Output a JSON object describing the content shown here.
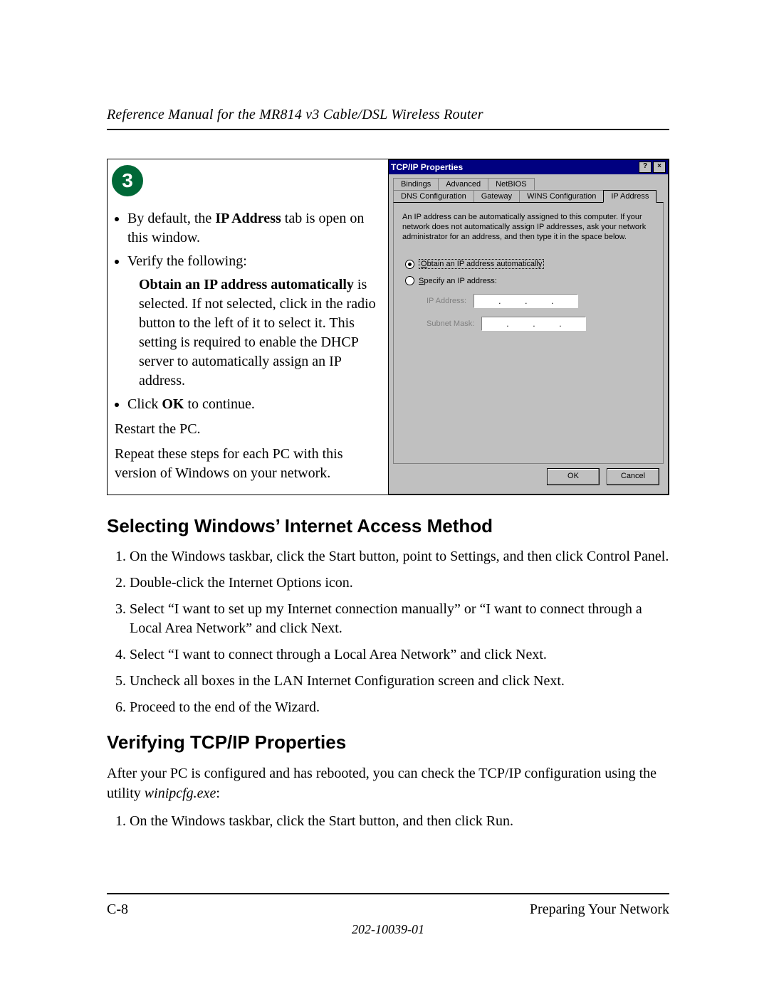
{
  "header": {
    "running_title": "Reference Manual for the MR814 v3 Cable/DSL Wireless Router"
  },
  "step": {
    "number": "3",
    "bullet1_pre": "By default, the ",
    "bullet1_bold": "IP Address",
    "bullet1_post": " tab is open on this window.",
    "bullet2": "Verify the following:",
    "obtain_phrase": "Obtain an IP address automatically",
    "obtain_rest": " is selected. If not selected, click in the radio button to the left of it to select it.  This setting is required to enable the DHCP server to automatically assign an IP address.",
    "bullet3_pre": "Click ",
    "bullet3_bold": "OK",
    "bullet3_post": " to continue.",
    "restart": "Restart the PC.",
    "repeat": "Repeat these steps for each PC with this version of Windows on your network."
  },
  "dialog": {
    "title": "TCP/IP Properties",
    "help_btn": "?",
    "close_btn": "×",
    "tabs_row1": {
      "bindings": "Bindings",
      "advanced": "Advanced",
      "netbios": "NetBIOS"
    },
    "tabs_row2": {
      "dns": "DNS Configuration",
      "gateway": "Gateway",
      "wins": "WINS Configuration",
      "ip": "IP Address"
    },
    "desc": "An IP address can be automatically assigned to this computer. If your network does not automatically assign IP addresses, ask your network administrator for an address, and then type it in the space below.",
    "radio_obtain_u": "O",
    "radio_obtain_rest": "btain an IP address automatically",
    "radio_specify_u": "S",
    "radio_specify_rest": "pecify an IP address:",
    "ip_label": "IP Address:",
    "subnet_label": "Subnet Mask:",
    "ok": "OK",
    "cancel": "Cancel"
  },
  "section1": {
    "title": "Selecting Windows’ Internet Access Method",
    "items": [
      "On the Windows taskbar, click the Start button, point to Settings, and then click Control Panel.",
      "Double-click the Internet Options icon.",
      "Select “I want to set up my Internet connection manually” or “I want to connect through a Local Area Network” and click Next.",
      "Select “I want to connect through a Local Area Network” and click Next.",
      "Uncheck all boxes in the LAN Internet Configuration screen and click Next.",
      "Proceed to the end of the Wizard."
    ]
  },
  "section2": {
    "title": "Verifying TCP/IP Properties",
    "intro_pre": "After your PC is configured and has rebooted, you can check the TCP/IP configuration using the utility ",
    "intro_file": "winipcfg.exe",
    "intro_post": ":",
    "items": [
      "On the Windows taskbar, click the Start button, and then click Run."
    ]
  },
  "footer": {
    "page": "C-8",
    "section": "Preparing Your Network",
    "docnum": "202-10039-01"
  }
}
